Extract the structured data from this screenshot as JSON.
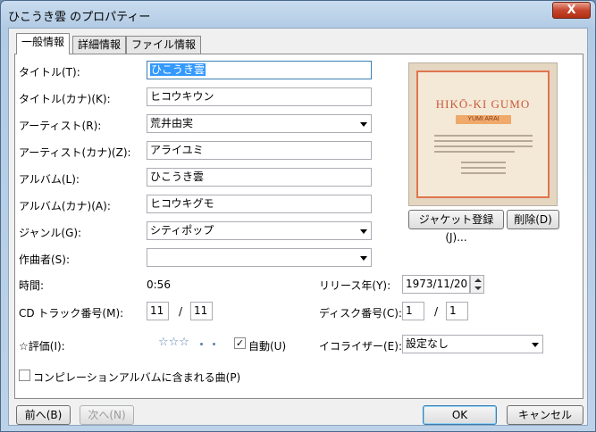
{
  "window": {
    "title": "ひこうき雲 のプロパティー",
    "close_glyph": "X"
  },
  "tabs": [
    {
      "label": "一般情報"
    },
    {
      "label": "詳細情報"
    },
    {
      "label": "ファイル情報"
    }
  ],
  "fields": {
    "title": {
      "label": "タイトル(T):",
      "value": "ひこうき雲"
    },
    "title_kana": {
      "label": "タイトル(カナ)(K):",
      "value": "ヒコウキウン"
    },
    "artist": {
      "label": "アーティスト(R):",
      "value": "荒井由実"
    },
    "artist_kana": {
      "label": "アーティスト(カナ)(Z):",
      "value": "アライユミ"
    },
    "album": {
      "label": "アルバム(L):",
      "value": "ひこうき雲"
    },
    "album_kana": {
      "label": "アルバム(カナ)(A):",
      "value": "ヒコウキグモ"
    },
    "genre": {
      "label": "ジャンル(G):",
      "value": "シティポップ"
    },
    "composer": {
      "label": "作曲者(S):",
      "value": ""
    }
  },
  "time": {
    "label": "時間:",
    "value": "0:56"
  },
  "release": {
    "label": "リリース年(Y):",
    "value": "1973/11/20"
  },
  "track": {
    "label": "CD トラック番号(M):",
    "number": "11",
    "total": "11",
    "sep": "/"
  },
  "disc": {
    "label": "ディスク番号(C):",
    "number": "1",
    "total": "1",
    "sep": "/"
  },
  "rating": {
    "label": "☆評価(I):",
    "stars": "☆☆☆",
    "auto_label": "自動(U)",
    "auto_checked": true
  },
  "equalizer": {
    "label": "イコライザー(E):",
    "value": "設定なし"
  },
  "compilation": {
    "label": "コンピレーションアルバムに含まれる曲(P)",
    "checked": false
  },
  "jacket": {
    "art_title": "HIKŌ-KI GUMO",
    "art_artist": "YUMI ARAI",
    "register_label": "ジャケット登録(J)...",
    "delete_label": "削除(D)"
  },
  "footer": {
    "prev_label": "前へ(B)",
    "next_label": "次へ(N)",
    "ok_label": "OK",
    "cancel_label": "キャンセル"
  }
}
